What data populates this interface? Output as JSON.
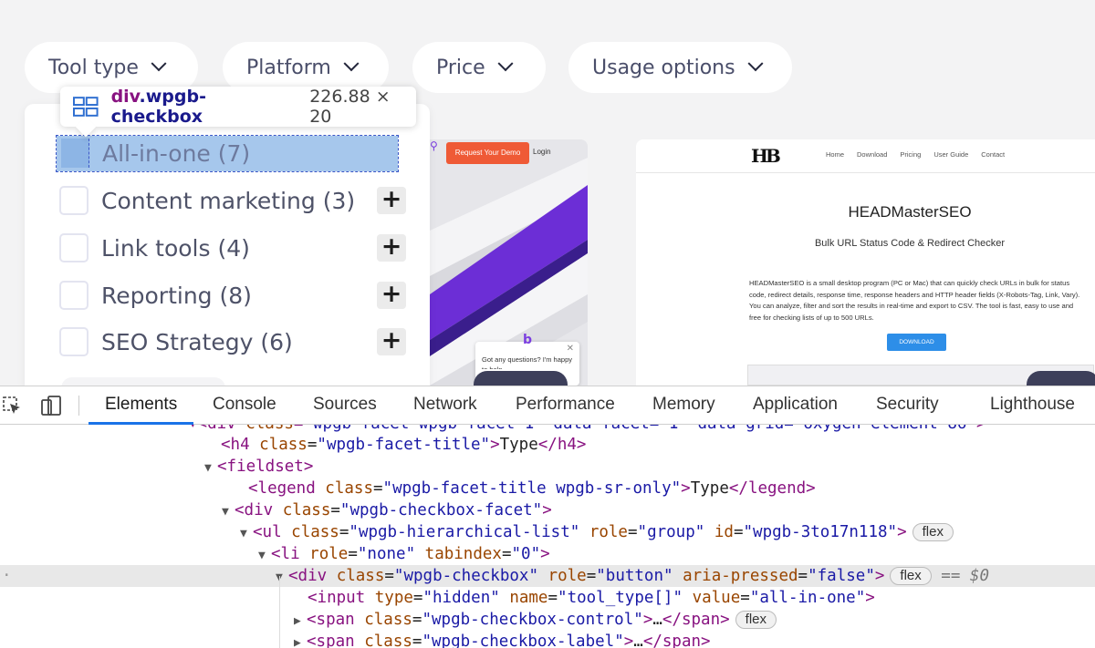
{
  "filters": [
    {
      "label": "Tool type"
    },
    {
      "label": "Platform"
    },
    {
      "label": "Price"
    },
    {
      "label": "Usage options"
    }
  ],
  "dropdown": {
    "highlighted": {
      "label": "All-in-one (7)"
    },
    "items": [
      {
        "label": "Content marketing (3)"
      },
      {
        "label": "Link tools (4)"
      },
      {
        "label": "Reporting (8)"
      },
      {
        "label": "SEO Strategy (6)"
      }
    ]
  },
  "tooltip": {
    "tag": "div",
    "class": ".wpgb-checkbox",
    "width": "226.88",
    "height": "20"
  },
  "card1": {
    "demo_button": "Request Your Demo",
    "login": "Login",
    "chat_text": "Got any questions? I'm happy to help."
  },
  "card2": {
    "logo": "HB",
    "nav": [
      "Home",
      "Download",
      "Pricing",
      "User Guide",
      "Contact"
    ],
    "title": "HEADMasterSEO",
    "subtitle": "Bulk URL Status Code & Redirect Checker",
    "body": "HEADMasterSEO is a small desktop program (PC or Mac) that can quickly check URLs in bulk for status code, redirect details, response time, response headers and HTTP header fields (X-Robots-Tag, Link, Vary). You can analyze, filter and sort the results in real-time and export to CSV. The tool is fast, easy to use and free for checking lists of up to 500 URLs.",
    "download": "DOWNLOAD"
  },
  "devtools": {
    "tabs": [
      "Elements",
      "Console",
      "Sources",
      "Network",
      "Performance",
      "Memory",
      "Application",
      "Security",
      "Lighthouse"
    ],
    "active_tab": "Elements",
    "code": {
      "h4_class": "wpgb-facet-title",
      "h4_text": "Type",
      "legend_class": "wpgb-facet-title wpgb-sr-only",
      "legend_text": "Type",
      "div_class": "wpgb-checkbox-facet",
      "ul_class": "wpgb-hierarchical-list",
      "ul_role": "group",
      "ul_id": "wpgb-3to17n118",
      "li_role": "none",
      "li_tabindex": "0",
      "sel_class": "wpgb-checkbox",
      "sel_role": "button",
      "sel_pressed": "false",
      "input_type": "hidden",
      "input_name": "tool_type[]",
      "input_value": "all-in-one",
      "span1_class": "wpgb-checkbox-control",
      "span2_class": "wpgb-checkbox-label",
      "badge": "flex",
      "dollar": "== $0"
    }
  }
}
